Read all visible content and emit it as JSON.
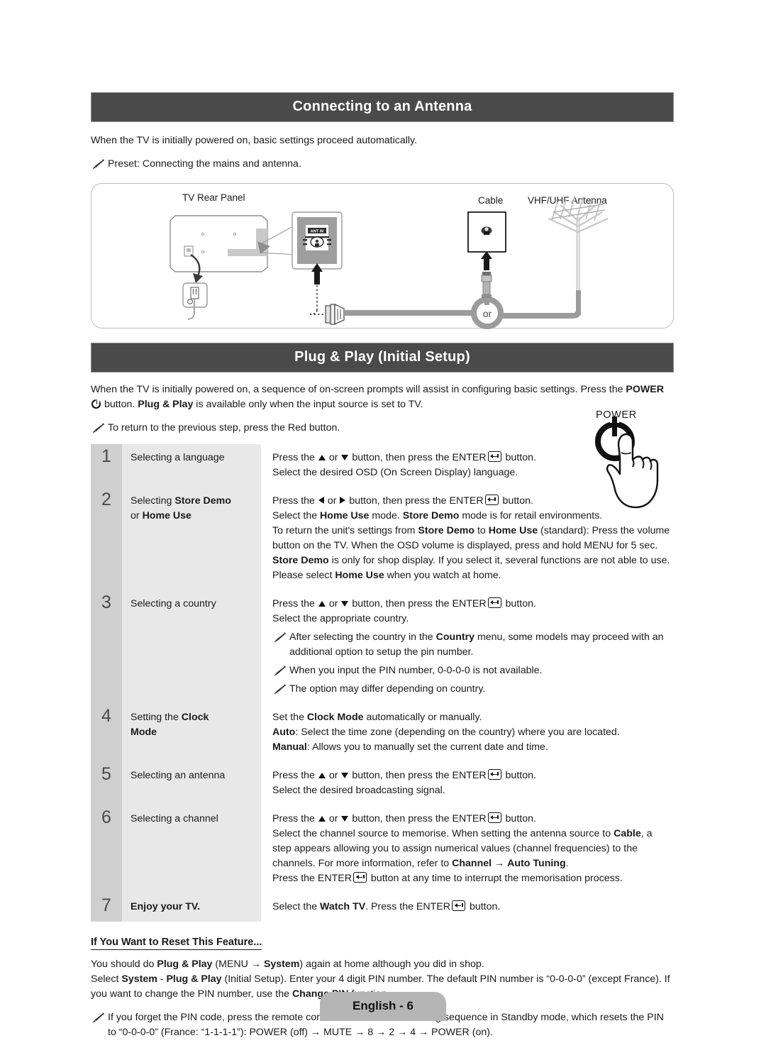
{
  "sections": {
    "antenna": {
      "title": "Connecting to an Antenna",
      "intro": "When the TV is initially powered on, basic settings proceed automatically.",
      "note": "Preset: Connecting the mains and antenna.",
      "diagram": {
        "label_tv_rear": "TV Rear Panel",
        "label_cable": "Cable",
        "label_antenna": "VHF/UHF Antenna",
        "label_ant_in": "ANT IN",
        "label_or": "or"
      }
    },
    "plugplay": {
      "title": "Plug & Play (Initial Setup)",
      "intro_p1_a": "When the TV is initially powered on, a sequence of on-screen prompts will assist in configuring basic settings. Press the ",
      "intro_p1_power": "POWER",
      "intro_p1_b": " button. ",
      "intro_p1_bold": "Plug & Play",
      "intro_p1_c": " is available only when the input source is set to TV.",
      "note": "To return to the previous step, press the Red button."
    }
  },
  "power_illustration": {
    "label": "POWER"
  },
  "steps": [
    {
      "num": "1",
      "label_plain_1": "Selecting a language",
      "lines": [
        {
          "pre": "Press the ",
          "mid": " or ",
          "post": " button, then press the ENTER",
          "tail": " button.",
          "arrows": "updown"
        },
        {
          "text": "Select the desired OSD (On Screen Display) language."
        }
      ]
    },
    {
      "num": "2",
      "label_plain_1": "Selecting ",
      "label_bold_1": "Store Demo",
      "label_plain_2": "or ",
      "label_bold_2": "Home Use",
      "lines": [
        {
          "pre": "Press the ",
          "mid": " or ",
          "post": " button, then press the ENTER",
          "tail": " button.",
          "arrows": "leftright"
        },
        {
          "text_a": "Select the ",
          "bold_a": "Home Use",
          "text_b": " mode. ",
          "bold_b": "Store Demo",
          "text_c": " mode is for retail environments."
        },
        {
          "text_a": "To return the unit's settings from ",
          "bold_a": "Store Demo",
          "text_b": " to ",
          "bold_b": "Home Use",
          "text_c": " (standard): Press the volume button on the TV. When the OSD volume is displayed, press and hold MENU for 5 sec."
        },
        {
          "bold_lead": "Store Demo",
          "text_a": " is only for shop display. If you select it, several functions are not able to use. Please select ",
          "bold_a": "Home Use",
          "text_b": " when you watch at home."
        }
      ]
    },
    {
      "num": "3",
      "label_plain_1": "Selecting a country",
      "lines": [
        {
          "pre": "Press the ",
          "mid": " or ",
          "post": " button, then press the ENTER",
          "tail": " button.",
          "arrows": "updown"
        },
        {
          "text": "Select the appropriate country."
        }
      ],
      "notes": [
        {
          "text_a": "After selecting the country in the ",
          "bold_a": "Country",
          "text_b": " menu, some models may proceed with an additional option to setup the pin number."
        },
        {
          "text": "When you input the PIN number, 0-0-0-0 is not available."
        },
        {
          "text": "The option may differ depending on country."
        }
      ]
    },
    {
      "num": "4",
      "label_plain_1": "Setting the ",
      "label_bold_1": "Clock",
      "label_bold_2": "Mode",
      "lines": [
        {
          "text_a": "Set the ",
          "bold_a": "Clock Mode",
          "text_b": " automatically or manually."
        },
        {
          "bold_lead": "Auto",
          "text_a": ": Select the time zone (depending on the country) where you are located."
        },
        {
          "bold_lead": "Manual",
          "text_a": ": Allows you to manually set the current date and time."
        }
      ]
    },
    {
      "num": "5",
      "label_plain_1": "Selecting an antenna",
      "lines": [
        {
          "pre": "Press the ",
          "mid": " or ",
          "post": " button, then press the ENTER",
          "tail": " button.",
          "arrows": "updown"
        },
        {
          "text": "Select the desired broadcasting signal."
        }
      ]
    },
    {
      "num": "6",
      "label_plain_1": "Selecting a channel",
      "lines": [
        {
          "pre": "Press the ",
          "mid": " or ",
          "post": " button, then press the ENTER",
          "tail": " button.",
          "arrows": "updown"
        },
        {
          "text_a": "Select the channel source to memorise. When setting the antenna source to ",
          "bold_a": "Cable",
          "text_b": ", a step appears allowing you to assign numerical values (channel frequencies) to the channels. For more information, refer to ",
          "bold_b": "Channel",
          "text_c": " → ",
          "bold_c": "Auto Tuning",
          "text_d": "."
        },
        {
          "pre2": "Press the ENTER",
          "tail2": " button at any time to interrupt the memorisation process."
        }
      ]
    },
    {
      "num": "7",
      "label_bold_only": "Enjoy your TV.",
      "lines": [
        {
          "text_a": "Select the ",
          "bold_a": "Watch TV",
          "text_b": ". Press the ENTER",
          "tail": " button."
        }
      ]
    }
  ],
  "reset": {
    "heading": "If You Want to Reset This Feature...",
    "line1_a": "You should do ",
    "line1_bold_1": "Plug & Play",
    "line1_b": " (MENU → ",
    "line1_bold_2": "System",
    "line1_c": ") again at home although you did in shop.",
    "line2_a": "Select ",
    "line2_bold_1": "System",
    "line2_b": " - ",
    "line2_bold_2": "Plug & Play",
    "line2_c": " (Initial Setup). Enter your 4 digit PIN number. The default PIN number is “0-0-0-0” (except France). If you want to change the PIN number, use the ",
    "line2_bold_3": "Change PIN",
    "line2_d": " function.",
    "note_a": "If you forget the PIN code, press the remote control buttons in the following sequence in Standby mode, which resets the PIN to “0-0-0-0” (France: “1-1-1-1”): POWER (off) → MUTE → 8 → 2 → 4 → POWER (on)."
  },
  "footer": {
    "page_label": "English - 6"
  },
  "colors": {
    "section_bar": "#4a4a4a",
    "step_number_cell": "#cfcfcf",
    "step_label_cell": "#e8e8e8",
    "footer_pill": "#b5b5b5",
    "text": "#1a1a1a"
  }
}
